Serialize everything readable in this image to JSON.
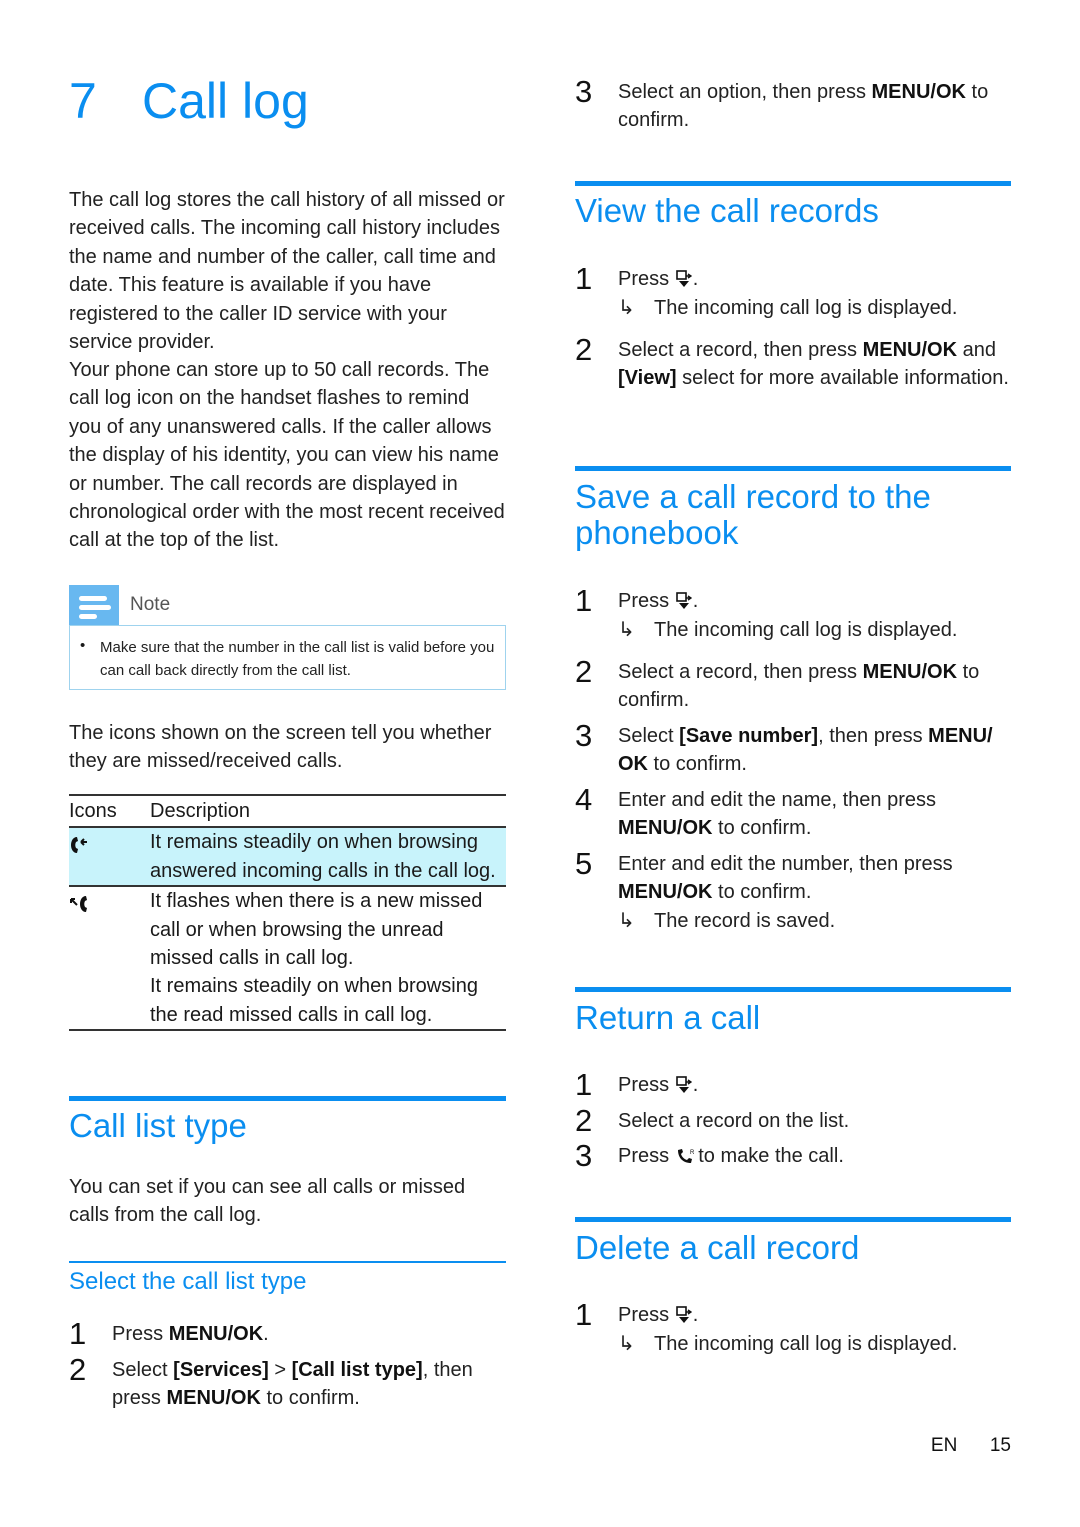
{
  "chapter": {
    "number": "7",
    "title": "Call log"
  },
  "intro": [
    "The call log stores the call history of all missed or received calls. The incoming call history includes the name and number of the caller, call time and date. This feature is available if you have registered to the caller ID service with your service provider.",
    "Your phone can store up to 50 call records. The call log icon on the handset flashes to remind you of any unanswered calls. If the caller allows the display of his identity, you can view his name or number. The call records are displayed in chronological order with the most recent received call at the top of the list."
  ],
  "note": {
    "label": "Note",
    "items": [
      "Make sure that the number in the call list is valid before you can call back directly from the call list."
    ]
  },
  "icons_intro": "The icons shown on the screen tell you whether they are missed/received calls.",
  "icon_table": {
    "headers": [
      "Icons",
      "Description"
    ],
    "rows": [
      {
        "icon": "answered-call-icon",
        "description": "It remains steadily on when browsing answered incoming calls in the call log."
      },
      {
        "icon": "missed-call-icon",
        "description": "It flashes when there is a new missed call or when browsing the unread missed calls in call log.\nIt remains steadily on when browsing the read missed calls in call log."
      }
    ]
  },
  "call_list_type": {
    "title": "Call list type",
    "text": "You can set if you can see all calls or missed calls from the call log.",
    "subsection": "Select the call list type",
    "steps": [
      {
        "num": "1",
        "pre": "Press ",
        "bold": "MENU/OK",
        "post": "."
      },
      {
        "num": "2",
        "pre": "Select ",
        "bold1": "[Services]",
        "mid": " > ",
        "bold2": "[Call list type]",
        "mid2": ", then press ",
        "bold3": "MENU/OK",
        "post": " to confirm."
      }
    ]
  },
  "cont_step": {
    "num": "3",
    "pre": "Select an option, then press ",
    "bold": "MENU/OK",
    "post": " to confirm."
  },
  "view_records": {
    "title": "View the call records",
    "steps": [
      {
        "num": "1",
        "pre": "Press ",
        "icon": "call-log-key-icon",
        "post": ".",
        "result": "The incoming call log is displayed."
      },
      {
        "num": "2",
        "pre": "Select a record, then press ",
        "bold": "MENU/OK",
        "mid": " and ",
        "bold2": "[View]",
        "post": " select for more available information."
      }
    ]
  },
  "save_record": {
    "title": "Save a call record to the phonebook",
    "steps": [
      {
        "num": "1",
        "pre": "Press ",
        "post": ".",
        "result": "The incoming call log is displayed."
      },
      {
        "num": "2",
        "pre": "Select a record, then press ",
        "bold": "MENU/OK",
        "post": " to confirm."
      },
      {
        "num": "3",
        "pre": "Select ",
        "bold": "[Save number]",
        "mid": ", then press ",
        "bold2": "MENU/ OK",
        "post": " to confirm."
      },
      {
        "num": "4",
        "pre": "Enter and edit the name, then press ",
        "bold": "MENU/OK",
        "post": " to confirm."
      },
      {
        "num": "5",
        "pre": "Enter and edit the number, then press ",
        "bold": "MENU/OK",
        "post": " to confirm.",
        "result": "The record is saved."
      }
    ]
  },
  "return_call": {
    "title": "Return a call",
    "steps": [
      {
        "num": "1",
        "pre": "Press ",
        "post": "."
      },
      {
        "num": "2",
        "pre": "Select a record on the list."
      },
      {
        "num": "3",
        "pre": "Press ",
        "post": " to make the call."
      }
    ]
  },
  "delete_record": {
    "title": "Delete a call record",
    "steps": [
      {
        "num": "1",
        "pre": "Press ",
        "post": ".",
        "result": "The incoming call log is displayed."
      }
    ]
  },
  "footer": {
    "lang": "EN",
    "page": "15"
  }
}
